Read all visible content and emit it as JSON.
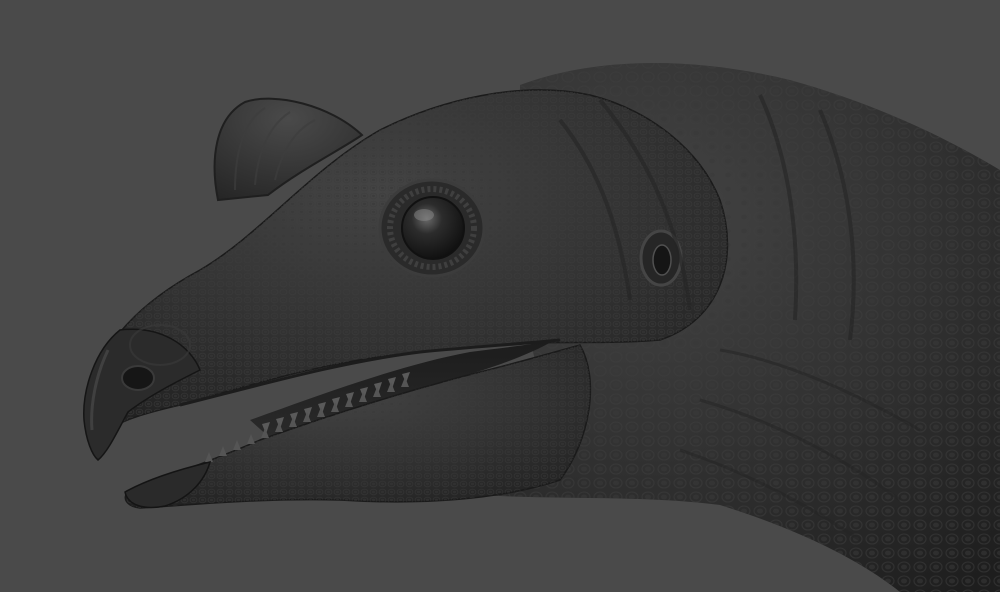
{
  "scene": {
    "subject": "dinosaur-head-sculpt",
    "background_color": "#4a4a4a",
    "skin_color": "#2f2f2f",
    "skin_highlight": "#5a5a5a",
    "skin_shadow": "#1a1a1a"
  }
}
